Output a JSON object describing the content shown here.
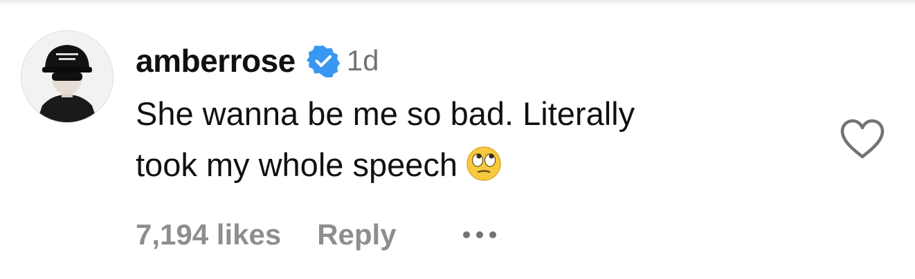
{
  "comment": {
    "username": "amberrose",
    "verified": true,
    "timestamp": "1d",
    "text_line1": "She wanna be me so bad. Literally",
    "text_line2": "took my whole speech",
    "emoji": "face-with-rolling-eyes",
    "likes_label": "7,194 likes",
    "reply_label": "Reply"
  },
  "icons": {
    "avatar": "user-avatar",
    "verified": "verified-badge-icon",
    "like": "heart-outline-icon",
    "more": "more-options-icon"
  },
  "colors": {
    "text_primary": "#111111",
    "text_secondary": "#737373",
    "action_text": "#8e8e8e",
    "verified_blue": "#3897f0",
    "background": "#ffffff"
  }
}
